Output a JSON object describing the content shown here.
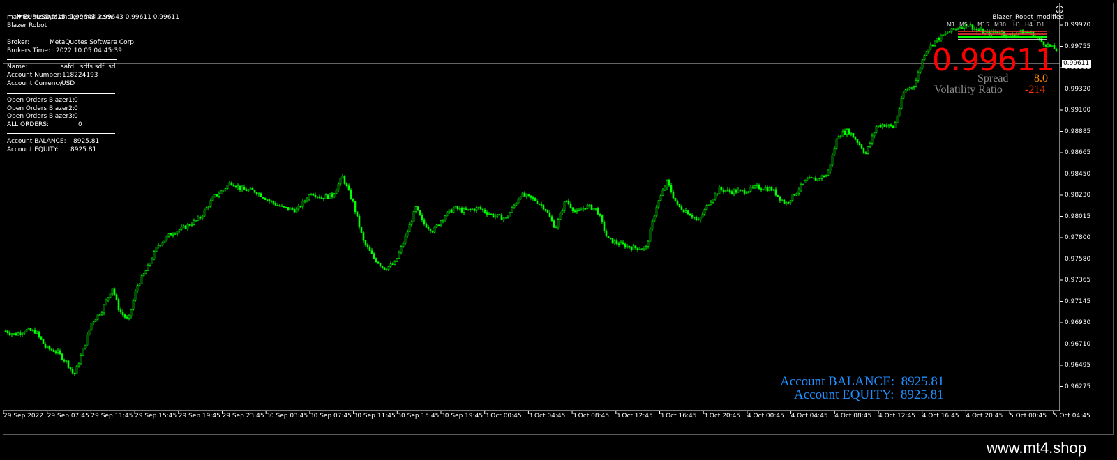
{
  "header": {
    "symbol_line": "EURUSD,M15  0.99643 0.99643 0.99611 0.99611",
    "mail": "mail to: susanto.andi@gmail.com",
    "robot": "Blazer Robot",
    "ea_name": "Blazer_Robot_modified"
  },
  "info": {
    "broker_label": "Broker:",
    "broker_value": "MetaQuotes Software Corp.",
    "time_label": "Brokers Time:",
    "time_value": "2022.10.05 04:45:39",
    "name_label": "Name:",
    "name_value": "safd   sdfs sdf  sd",
    "acct_num_label": "Account Number:",
    "acct_num_value": "118224193",
    "currency_label": "Account Currency:",
    "currency_value": "USD",
    "orders1_label": "Open Orders Blazer1:",
    "orders1_value": "0",
    "orders2_label": "Open Orders Blazer2:",
    "orders2_value": "0",
    "orders3_label": "Open Orders Blazer3:",
    "orders3_value": "0",
    "all_orders_label": "ALL ORDERS:",
    "all_orders_value": "0",
    "balance_label": "Account BALANCE:",
    "balance_value": "8925.81",
    "equity_label": "Account EQUITY:",
    "equity_value": "8925.81"
  },
  "overlay": {
    "bid": "0.99611",
    "spread_label": "Spread",
    "spread_value": "8.0",
    "volatility_label": "Volatility Ratio",
    "volatility_value": "-214",
    "timeframes": [
      "M1",
      "M5",
      "M15",
      "M30",
      "H1",
      "H4",
      "D1"
    ],
    "balance_text": "Account BALANCE:  8925.81",
    "equity_text": "Account EQUITY:  8925.81"
  },
  "price_axis": {
    "labels": [
      "0.99970",
      "0.99755",
      "0.99535",
      "0.99320",
      "0.99100",
      "0.98885",
      "0.98665",
      "0.98450",
      "0.98230",
      "0.98015",
      "0.97800",
      "0.97580",
      "0.97365",
      "0.97145",
      "0.96930",
      "0.96710",
      "0.96495",
      "0.96275"
    ],
    "current": "0.99611"
  },
  "time_axis": {
    "labels": [
      "29 Sep 2022",
      "29 Sep 07:45",
      "29 Sep 11:45",
      "29 Sep 15:45",
      "29 Sep 19:45",
      "29 Sep 23:45",
      "30 Sep 03:45",
      "30 Sep 07:45",
      "30 Sep 11:45",
      "30 Sep 15:45",
      "30 Sep 19:45",
      "3 Oct 00:45",
      "3 Oct 04:45",
      "3 Oct 08:45",
      "3 Oct 12:45",
      "3 Oct 16:45",
      "3 Oct 20:45",
      "4 Oct 00:45",
      "4 Oct 04:45",
      "4 Oct 08:45",
      "4 Oct 12:45",
      "4 Oct 16:45",
      "4 Oct 20:45",
      "5 Oct 00:45",
      "5 Oct 04:45"
    ]
  },
  "chart_data": {
    "type": "candlestick",
    "ylim": [
      0.9619,
      1.0003
    ],
    "path_points": [
      [
        0,
        0.9693
      ],
      [
        15,
        0.9689
      ],
      [
        30,
        0.9693
      ],
      [
        45,
        0.9692
      ],
      [
        60,
        0.9676
      ],
      [
        75,
        0.9673
      ],
      [
        90,
        0.9662
      ],
      [
        100,
        0.965
      ],
      [
        110,
        0.9668
      ],
      [
        125,
        0.97
      ],
      [
        140,
        0.9712
      ],
      [
        155,
        0.9734
      ],
      [
        165,
        0.9712
      ],
      [
        178,
        0.9702
      ],
      [
        190,
        0.9735
      ],
      [
        205,
        0.9752
      ],
      [
        220,
        0.9774
      ],
      [
        240,
        0.9786
      ],
      [
        260,
        0.9792
      ],
      [
        280,
        0.98
      ],
      [
        300,
        0.982
      ],
      [
        315,
        0.9828
      ],
      [
        325,
        0.9835
      ],
      [
        340,
        0.9828
      ],
      [
        360,
        0.9826
      ],
      [
        380,
        0.9817
      ],
      [
        400,
        0.981
      ],
      [
        420,
        0.9808
      ],
      [
        440,
        0.9825
      ],
      [
        455,
        0.982
      ],
      [
        470,
        0.9822
      ],
      [
        485,
        0.984
      ],
      [
        500,
        0.9815
      ],
      [
        515,
        0.9778
      ],
      [
        530,
        0.9762
      ],
      [
        545,
        0.9752
      ],
      [
        560,
        0.9757
      ],
      [
        575,
        0.9782
      ],
      [
        590,
        0.981
      ],
      [
        600,
        0.9796
      ],
      [
        615,
        0.9788
      ],
      [
        630,
        0.9802
      ],
      [
        645,
        0.981
      ],
      [
        660,
        0.9807
      ],
      [
        680,
        0.981
      ],
      [
        700,
        0.9803
      ],
      [
        720,
        0.98
      ],
      [
        740,
        0.9823
      ],
      [
        760,
        0.9818
      ],
      [
        775,
        0.981
      ],
      [
        790,
        0.9791
      ],
      [
        805,
        0.9818
      ],
      [
        820,
        0.9805
      ],
      [
        835,
        0.9812
      ],
      [
        850,
        0.9808
      ],
      [
        865,
        0.978
      ],
      [
        880,
        0.9776
      ],
      [
        900,
        0.9772
      ],
      [
        920,
        0.9772
      ],
      [
        935,
        0.9812
      ],
      [
        950,
        0.9835
      ],
      [
        965,
        0.9812
      ],
      [
        980,
        0.9806
      ],
      [
        995,
        0.9797
      ],
      [
        1010,
        0.9815
      ],
      [
        1025,
        0.9828
      ],
      [
        1040,
        0.9826
      ],
      [
        1060,
        0.9826
      ],
      [
        1080,
        0.983
      ],
      [
        1100,
        0.9828
      ],
      [
        1120,
        0.9814
      ],
      [
        1135,
        0.9825
      ],
      [
        1150,
        0.9837
      ],
      [
        1165,
        0.9838
      ],
      [
        1180,
        0.9842
      ],
      [
        1195,
        0.988
      ],
      [
        1210,
        0.9884
      ],
      [
        1225,
        0.9872
      ],
      [
        1235,
        0.9862
      ],
      [
        1250,
        0.9888
      ],
      [
        1260,
        0.989
      ],
      [
        1275,
        0.9887
      ],
      [
        1290,
        0.9922
      ],
      [
        1305,
        0.9928
      ],
      [
        1320,
        0.996
      ],
      [
        1335,
        0.997
      ],
      [
        1350,
        0.9977
      ],
      [
        1365,
        0.9982
      ],
      [
        1380,
        0.9986
      ],
      [
        1395,
        0.998
      ],
      [
        1410,
        0.9977
      ],
      [
        1425,
        0.9979
      ],
      [
        1440,
        0.9975
      ],
      [
        1455,
        0.9978
      ],
      [
        1470,
        0.9978
      ],
      [
        1485,
        0.997
      ],
      [
        1500,
        0.9964
      ],
      [
        1510,
        0.9961
      ]
    ]
  },
  "footer": {
    "brand": "www.mt4.shop"
  },
  "colors": {
    "bull": "#00ff00",
    "bear": "#00ff00",
    "grid": "#ffffff",
    "bid": "#ff0000",
    "spread": "#ff8c00",
    "acct": "#1e90ff"
  }
}
